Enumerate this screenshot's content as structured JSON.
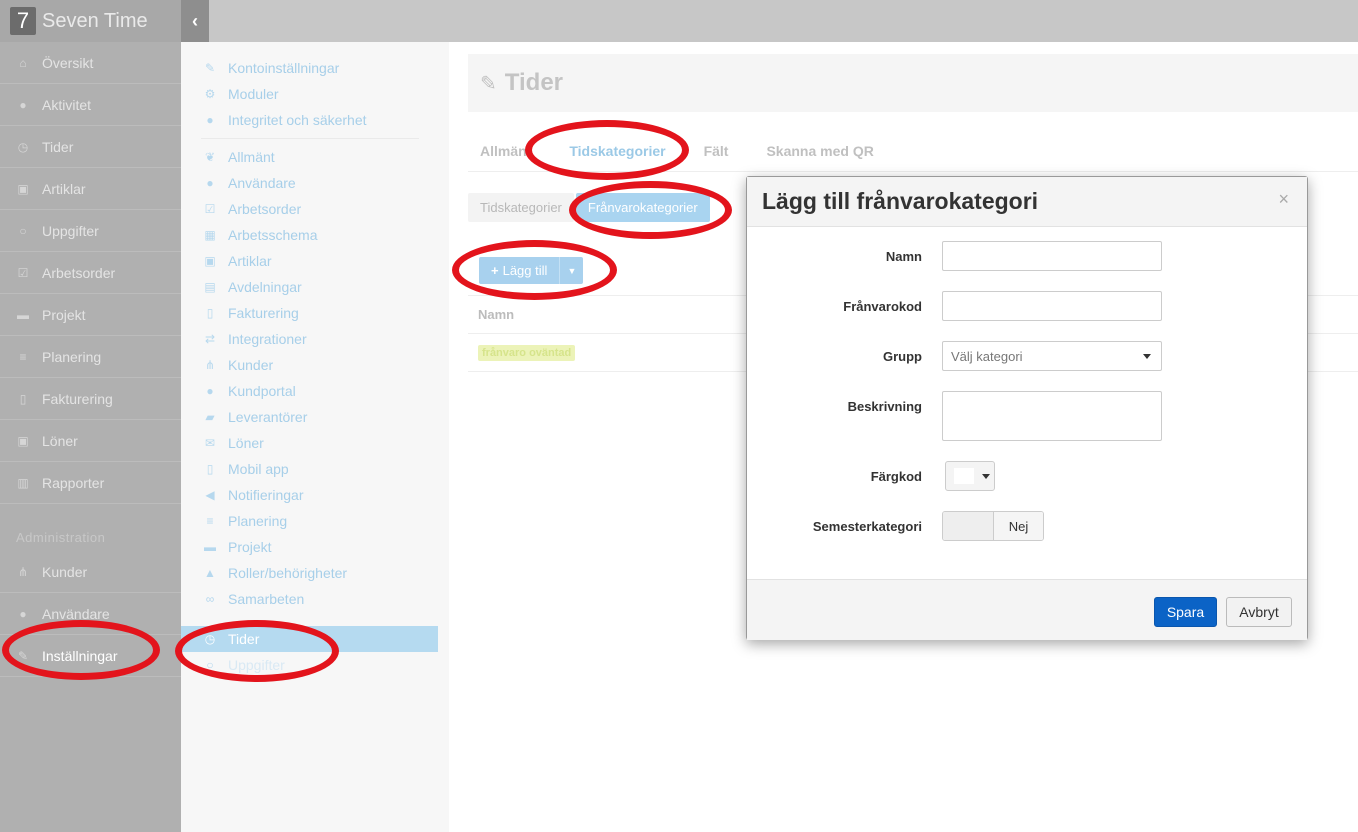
{
  "app": {
    "logo_char": "7",
    "name": "Seven Time",
    "collapse_icon": "chevron-left-icon"
  },
  "leftnav": {
    "items": [
      {
        "label": "Översikt",
        "icon": "home-icon",
        "glyph": "⌂"
      },
      {
        "label": "Aktivitet",
        "icon": "map-marker-icon",
        "glyph": "●"
      },
      {
        "label": "Tider",
        "icon": "clock-icon",
        "glyph": "◷"
      },
      {
        "label": "Artiklar",
        "icon": "money-icon",
        "glyph": "▣"
      },
      {
        "label": "Uppgifter",
        "icon": "circle-icon",
        "glyph": "○"
      },
      {
        "label": "Arbetsorder",
        "icon": "check-square-icon",
        "glyph": "☑"
      },
      {
        "label": "Projekt",
        "icon": "briefcase-icon",
        "glyph": "▬"
      },
      {
        "label": "Planering",
        "icon": "align-left-icon",
        "glyph": "≡"
      },
      {
        "label": "Fakturering",
        "icon": "file-icon",
        "glyph": "▯"
      },
      {
        "label": "Löner",
        "icon": "money-icon",
        "glyph": "▣"
      },
      {
        "label": "Rapporter",
        "icon": "bar-chart-icon",
        "glyph": "▥"
      }
    ],
    "section_title": "Administration",
    "admin_items": [
      {
        "label": "Kunder",
        "icon": "sitemap-icon",
        "glyph": "⋔"
      },
      {
        "label": "Användare",
        "icon": "user-icon",
        "glyph": "●"
      },
      {
        "label": "Inställningar",
        "icon": "wrench-icon",
        "glyph": "✎"
      }
    ]
  },
  "settings_menu": {
    "group1": [
      {
        "label": "Kontoinställningar",
        "icon": "wrench-icon",
        "glyph": "✎"
      },
      {
        "label": "Moduler",
        "icon": "cogs-icon",
        "glyph": "⚙"
      },
      {
        "label": "Integritet och säkerhet",
        "icon": "circle-icon",
        "glyph": "●"
      }
    ],
    "group2": [
      {
        "label": "Allmänt",
        "icon": "leaf-icon",
        "glyph": "❦"
      },
      {
        "label": "Användare",
        "icon": "user-icon",
        "glyph": "●"
      },
      {
        "label": "Arbetsorder",
        "icon": "check-square-icon",
        "glyph": "☑"
      },
      {
        "label": "Arbetsschema",
        "icon": "calendar-icon",
        "glyph": "▦"
      },
      {
        "label": "Artiklar",
        "icon": "money-icon",
        "glyph": "▣"
      },
      {
        "label": "Avdelningar",
        "icon": "clipboard-icon",
        "glyph": "▤"
      },
      {
        "label": "Fakturering",
        "icon": "file-icon",
        "glyph": "▯"
      },
      {
        "label": "Integrationer",
        "icon": "exchange-icon",
        "glyph": "⇄"
      },
      {
        "label": "Kunder",
        "icon": "sitemap-icon",
        "glyph": "⋔"
      },
      {
        "label": "Kundportal",
        "icon": "users-icon",
        "glyph": "●"
      },
      {
        "label": "Leverantörer",
        "icon": "truck-icon",
        "glyph": "▰"
      },
      {
        "label": "Löner",
        "icon": "envelope-icon",
        "glyph": "✉"
      },
      {
        "label": "Mobil app",
        "icon": "mobile-icon",
        "glyph": "▯"
      },
      {
        "label": "Notifieringar",
        "icon": "bullhorn-icon",
        "glyph": "◀"
      },
      {
        "label": "Planering",
        "icon": "align-left-icon",
        "glyph": "≡"
      },
      {
        "label": "Projekt",
        "icon": "briefcase-icon",
        "glyph": "▬"
      },
      {
        "label": "Roller/behörigheter",
        "icon": "lock-icon",
        "glyph": "▲"
      },
      {
        "label": "Samarbeten",
        "icon": "handshake-icon",
        "glyph": "∞"
      }
    ],
    "selected": {
      "label": "Tider",
      "icon": "clock-icon",
      "glyph": "◷"
    },
    "after_selected": {
      "label": "Uppgifter",
      "icon": "circle-icon",
      "glyph": "○"
    }
  },
  "main": {
    "title": "Tider",
    "title_icon": "wrench-icon",
    "tabs": [
      "Allmänt",
      "Tidskategorier",
      "Fält",
      "Skanna med QR"
    ],
    "active_tab": "Tidskategorier",
    "subtabs": [
      "Tidskategorier",
      "Frånvarokategorier"
    ],
    "active_subtab": "Frånvarokategorier",
    "add_button": "Lägg till",
    "table": {
      "columns": [
        "Namn"
      ],
      "rows": [
        {
          "name": "frånvaro oväntad"
        }
      ]
    }
  },
  "modal": {
    "title": "Lägg till frånvarokategori",
    "close": "×",
    "fields": {
      "name_label": "Namn",
      "name_value": "",
      "code_label": "Frånvarokod",
      "code_value": "",
      "group_label": "Grupp",
      "group_placeholder": "Välj kategori",
      "desc_label": "Beskrivning",
      "desc_value": "",
      "color_label": "Färgkod",
      "vacation_label": "Semesterkategori",
      "vacation_value": "Nej"
    },
    "save_button": "Spara",
    "cancel_button": "Avbryt"
  },
  "colors": {
    "primary": "#0b63c6",
    "annotation": "#e3141c",
    "nav_bg": "#b0b0b0"
  }
}
